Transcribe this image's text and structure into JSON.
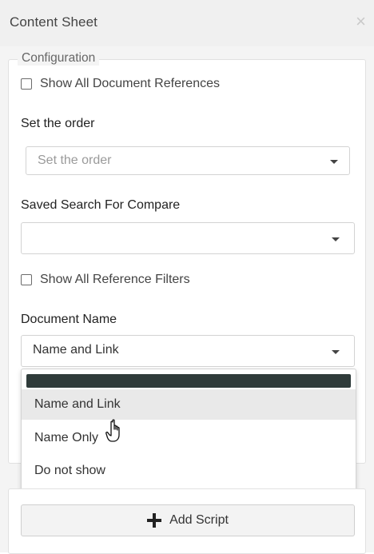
{
  "header": {
    "title": "Content Sheet",
    "close_glyph": "×"
  },
  "configuration": {
    "legend": "Configuration",
    "show_all_doc_refs_label": "Show All Document References",
    "set_order": {
      "label": "Set the order",
      "placeholder": "Set the order"
    },
    "saved_search": {
      "label": "Saved Search For Compare",
      "value": ""
    },
    "show_all_ref_filters_label": "Show All Reference Filters",
    "document_name": {
      "label": "Document Name",
      "value": "Name and Link",
      "options": [
        "Name and Link",
        "Name Only",
        "Do not show"
      ]
    }
  },
  "scripts": {
    "add_script_label": "Add Script"
  },
  "colors": {
    "dropdown_header_bar": "#2f3b3a",
    "highlight": "#e9e9e9"
  }
}
